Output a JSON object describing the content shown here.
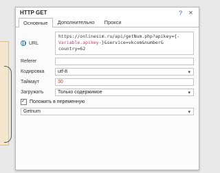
{
  "dialog": {
    "title": "HTTP GET",
    "help_icon": "question-icon",
    "close_icon": "close-icon"
  },
  "tabs": [
    {
      "label": "Основные"
    },
    {
      "label": "Дополнительно"
    },
    {
      "label": "Прокси"
    }
  ],
  "form": {
    "url_label": "URL",
    "url_line1": "https://onlinesim.ru/api/getNum.php?apikey={-",
    "url_var": "Variable.apikey",
    "url_line2_rest": "-}&service=vkcom&number&",
    "url_line3": "country=62",
    "referer_label": "Referer",
    "referer_value": "",
    "encoding_label": "Кодировка",
    "encoding_value": "utf-8",
    "timeout_label": "Таймаут",
    "timeout_value": "30",
    "load_label": "Загружать",
    "load_value": "Только содержимое",
    "put_var_label": "Положить в переменную",
    "put_var_checked": true,
    "variable_value": "Getnum"
  }
}
